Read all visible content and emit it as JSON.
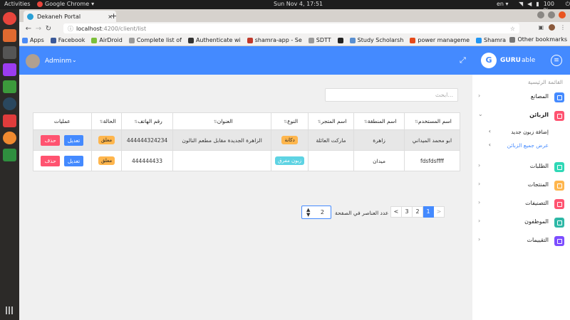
{
  "os": {
    "activities": "Activities",
    "app_name": "Google Chrome",
    "clock": "Sun Nov  4, 17:51",
    "keyboard_lang": "en",
    "battery": "100 %"
  },
  "dock": [
    {
      "icon": "chrome-icon",
      "color": "#e8453c"
    },
    {
      "icon": "files-icon",
      "color": "#e06a30"
    },
    {
      "icon": "terminal-icon",
      "color": "#555555"
    },
    {
      "icon": "phpstorm-icon",
      "color": "#9b3cf0"
    },
    {
      "icon": "app-green-icon",
      "color": "#3c9a3c"
    },
    {
      "icon": "steam-icon",
      "color": "#2a475e"
    },
    {
      "icon": "app-red-icon",
      "color": "#e03c3c"
    },
    {
      "icon": "app-orange-icon",
      "color": "#f08a30"
    },
    {
      "icon": "spreadsheet-icon",
      "color": "#2f8f3f"
    }
  ],
  "browser": {
    "tab_title": "Dekaneh Portal",
    "url_host": "localhost",
    "url_path": ":4200/client/list",
    "bookmarks": [
      {
        "label": "Apps",
        "color": "#4c8bf5"
      },
      {
        "label": "Facebook",
        "color": "#3b5998"
      },
      {
        "label": "AirDroid",
        "color": "#7bbf3a"
      },
      {
        "label": "Complete list of",
        "color": "#999999"
      },
      {
        "label": "Authenticate wi",
        "color": "#333333"
      },
      {
        "label": "shamra-app - Se",
        "color": "#c0392b"
      },
      {
        "label": "SDTT",
        "color": "#999999"
      },
      {
        "label": "",
        "color": "#222222"
      },
      {
        "label": "Study Scholarsh",
        "color": "#5a8fd0"
      },
      {
        "label": "power manageme",
        "color": "#e64a19"
      },
      {
        "label": "Shamra - Proto...",
        "color": "#2196f3"
      }
    ],
    "other_bookmarks": "Other bookmarks"
  },
  "app": {
    "user_name": "Adminm",
    "brand_bold": "GURU",
    "brand_light": "able",
    "logo_letter": "G",
    "accent": "#448aff"
  },
  "search": {
    "placeholder": "ابحث..."
  },
  "table": {
    "headers": [
      "اسم المستخدم",
      "اسم المنطقة",
      "اسم المتجر",
      "النوع",
      "العنوان",
      "رقم الهاتف",
      "الحالة",
      "عمليات"
    ],
    "rows": [
      {
        "username": "ابو محمد الميداني",
        "region": "زاهرة",
        "store": "ماركت العائلة",
        "type": "دكانة",
        "type_style": "yellow",
        "address": "الزاهرة الجديدة مقابل مطعم النالون",
        "phone": "444444324234",
        "status": "معلق"
      },
      {
        "username": "fdsfdsffff",
        "region": "ميدان",
        "store": "",
        "type": "زبون مفرق",
        "type_style": "cyan",
        "address": "",
        "phone": "444444433",
        "status": "معلق"
      }
    ],
    "edit_label": "تعديل",
    "delete_label": "حذف"
  },
  "pagination": {
    "prev": "<",
    "pages": [
      "1",
      "2",
      "3"
    ],
    "active": "1",
    "next": ">",
    "per_page_label": "عدد العناصر في الصفحة",
    "per_page_value": "2"
  },
  "sidebar": {
    "title": "القائمة الرئيسية",
    "items": [
      {
        "label": "المصانع",
        "color": "#448aff",
        "expanded": false
      },
      {
        "label": "الزبائن",
        "color": "#ff5370",
        "expanded": true
      },
      {
        "label": "الطلبات",
        "color": "#2ed8b6",
        "expanded": false
      },
      {
        "label": "المنتجات",
        "color": "#ffb64d",
        "expanded": false
      },
      {
        "label": "التصنيفات",
        "color": "#ff5370",
        "expanded": false
      },
      {
        "label": "الموظفون",
        "color": "#2eb8a6",
        "expanded": false
      },
      {
        "label": "التقييمات",
        "color": "#7c4dff",
        "expanded": false
      }
    ],
    "sub_items": [
      {
        "label": "إضافة زبون جديد",
        "active": false
      },
      {
        "label": "عرض جميع الزبائن",
        "active": true
      }
    ]
  }
}
